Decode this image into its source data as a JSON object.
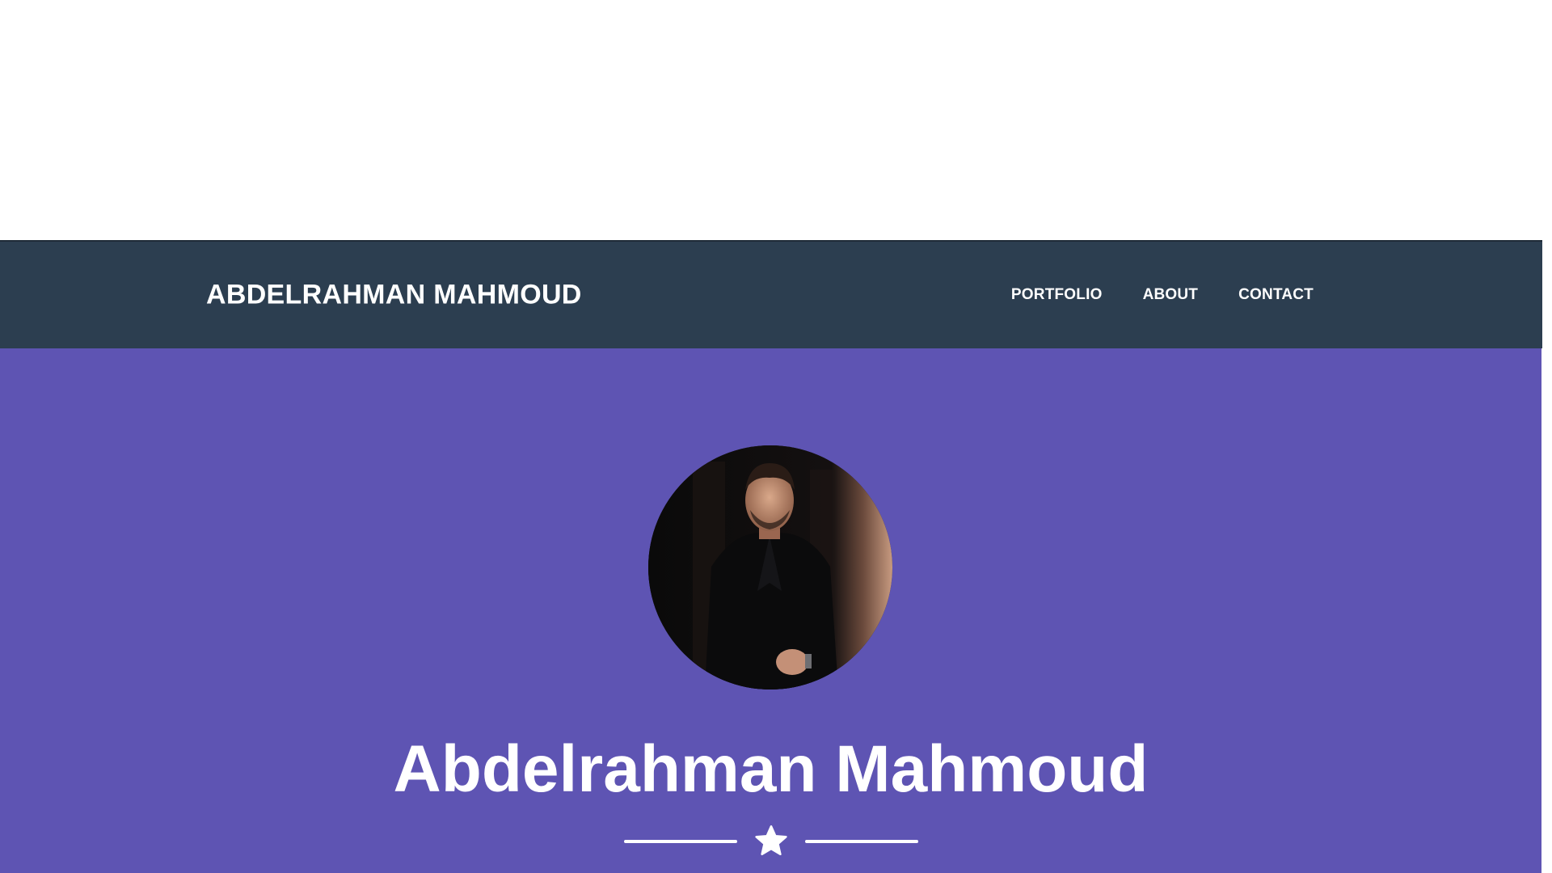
{
  "navbar": {
    "brand": "ABDELRAHMAN MAHMOUD",
    "links": [
      {
        "label": "PORTFOLIO"
      },
      {
        "label": "ABOUT"
      },
      {
        "label": "CONTACT"
      }
    ],
    "background_color": "#2c3e50"
  },
  "hero": {
    "background_color": "#5e54b3",
    "avatar_alt": "profile photo",
    "title": "Abdelrahman Mahmoud",
    "divider_icon": "star-icon"
  }
}
